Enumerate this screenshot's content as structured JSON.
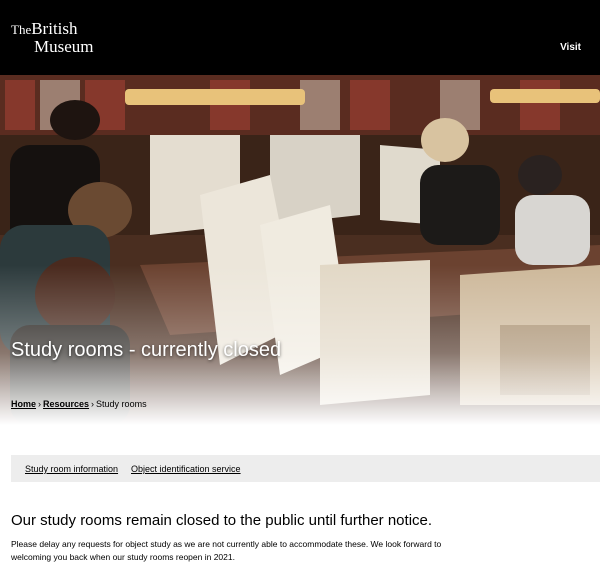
{
  "header": {
    "logo_the": "The",
    "logo_line1": "British",
    "logo_line2": "Museum",
    "visit_label": "Visit"
  },
  "hero": {
    "title": "Study rooms - currently closed"
  },
  "breadcrumb": {
    "home": "Home",
    "resources": "Resources",
    "current": "Study rooms",
    "separator": "›"
  },
  "subnav": {
    "items": [
      "Study room information",
      "Object identification service"
    ]
  },
  "main": {
    "heading": "Our study rooms remain closed to the public until further notice.",
    "paragraph": "Please delay any requests for object study as we are not currently able to accommodate these. We look forward to welcoming you back when our study rooms reopen in 2021."
  },
  "colors": {
    "header_bg": "#000000",
    "subnav_bg": "#ededed"
  }
}
